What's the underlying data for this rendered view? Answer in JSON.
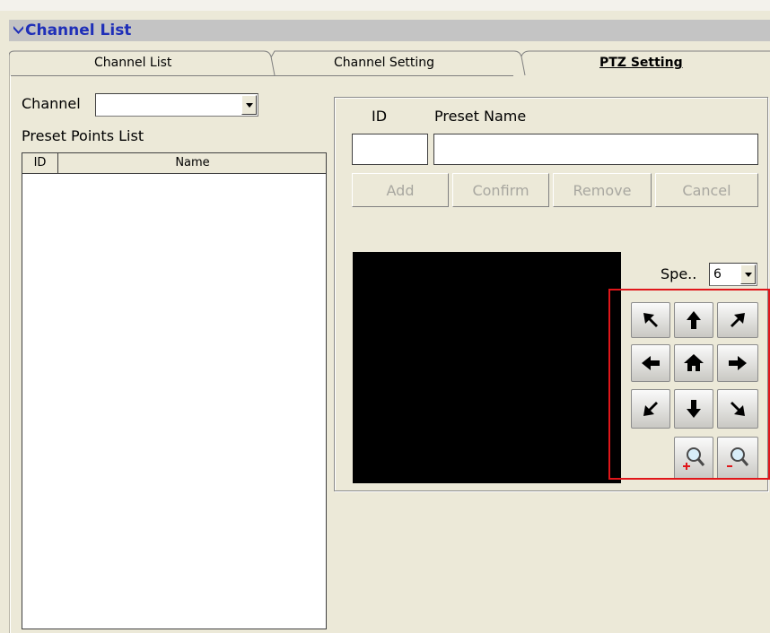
{
  "header": {
    "title": "Channel List",
    "icon": "expand-arrow-icon",
    "color": "#1f2fb8"
  },
  "tabs": [
    {
      "label": "Channel List",
      "active": false
    },
    {
      "label": "Channel Setting",
      "active": false
    },
    {
      "label": "PTZ Setting",
      "active": true
    }
  ],
  "left": {
    "channel_label": "Channel",
    "channel_value": "",
    "preset_list_label": "Preset Points List",
    "columns": [
      "ID",
      "Name"
    ],
    "rows": []
  },
  "preset": {
    "id_label": "ID",
    "name_label": "Preset Name",
    "id_value": "",
    "name_value": "",
    "buttons": {
      "add": "Add",
      "confirm": "Confirm",
      "remove": "Remove",
      "cancel": "Cancel"
    }
  },
  "ptz": {
    "speed_label": "Spe..",
    "speed_value": "6",
    "controls": [
      "up-left-arrow-icon",
      "up-arrow-icon",
      "up-right-arrow-icon",
      "left-arrow-icon",
      "home-icon",
      "right-arrow-icon",
      "down-left-arrow-icon",
      "down-arrow-icon",
      "down-right-arrow-icon",
      "zoom-in-icon",
      "zoom-out-icon"
    ],
    "highlight_color": "#e0161a"
  }
}
